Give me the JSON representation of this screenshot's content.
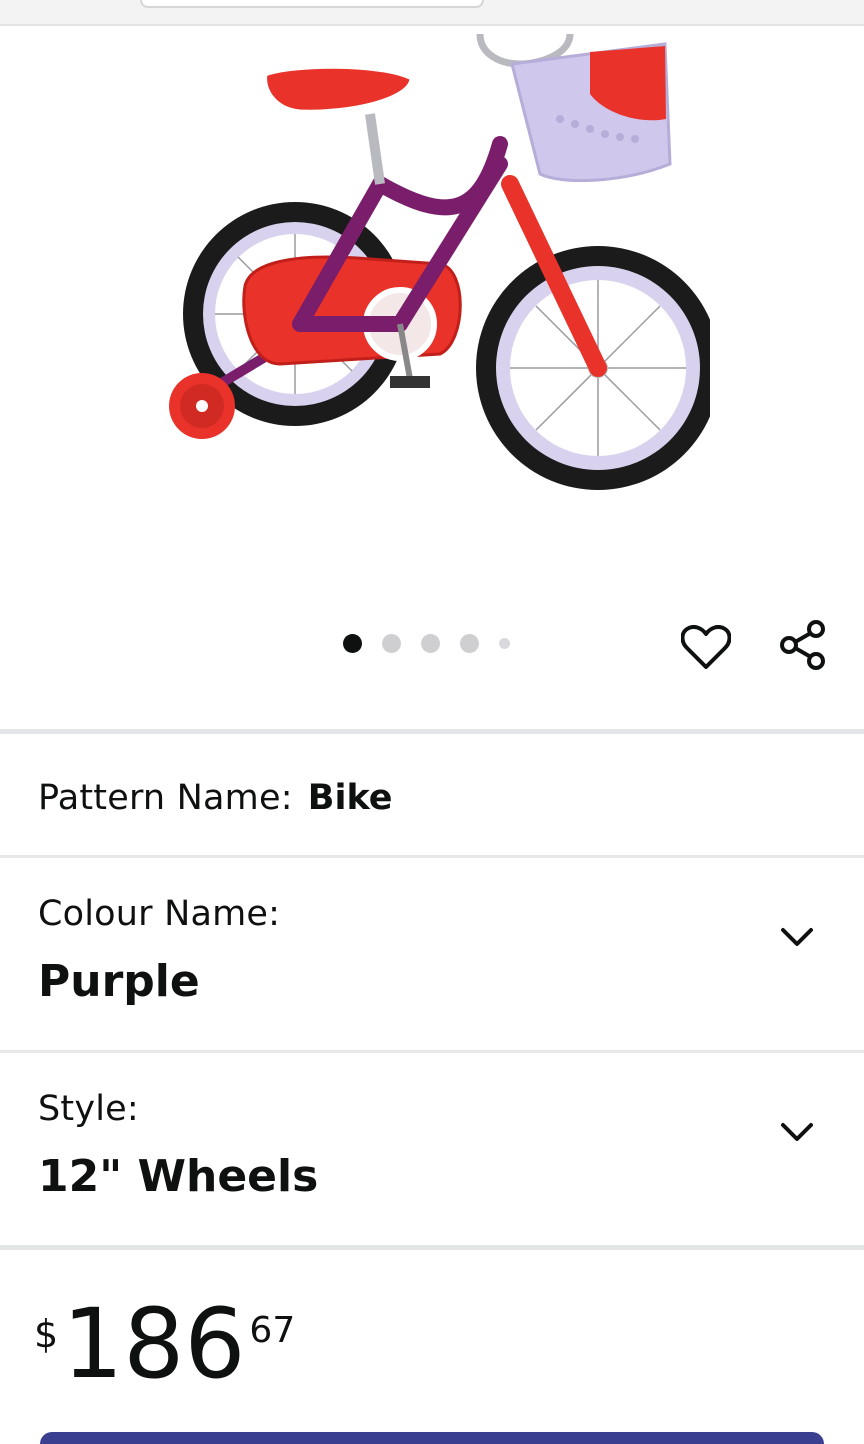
{
  "product": {
    "image_alt": "Purple kids bike with red accents, white front basket and training wheels",
    "carousel": {
      "count": 5,
      "active_index": 0
    }
  },
  "icons": {
    "wishlist": "heart-icon",
    "share": "share-icon",
    "expand": "chevron-down-icon"
  },
  "variations": {
    "pattern": {
      "label": "Pattern Name:",
      "value": "Bike"
    },
    "colour": {
      "label": "Colour Name:",
      "value": "Purple"
    },
    "style": {
      "label": "Style:",
      "value": "12\" Wheels"
    }
  },
  "price": {
    "symbol": "$",
    "whole": "186",
    "fraction": "67"
  },
  "colors": {
    "text": "#0f1111",
    "divider": "#e3e6e6",
    "bike_frame": "#7a1e6c",
    "bike_accent": "#e8322a",
    "basket": "#cfc7ec",
    "button": "#3a3f8f"
  }
}
